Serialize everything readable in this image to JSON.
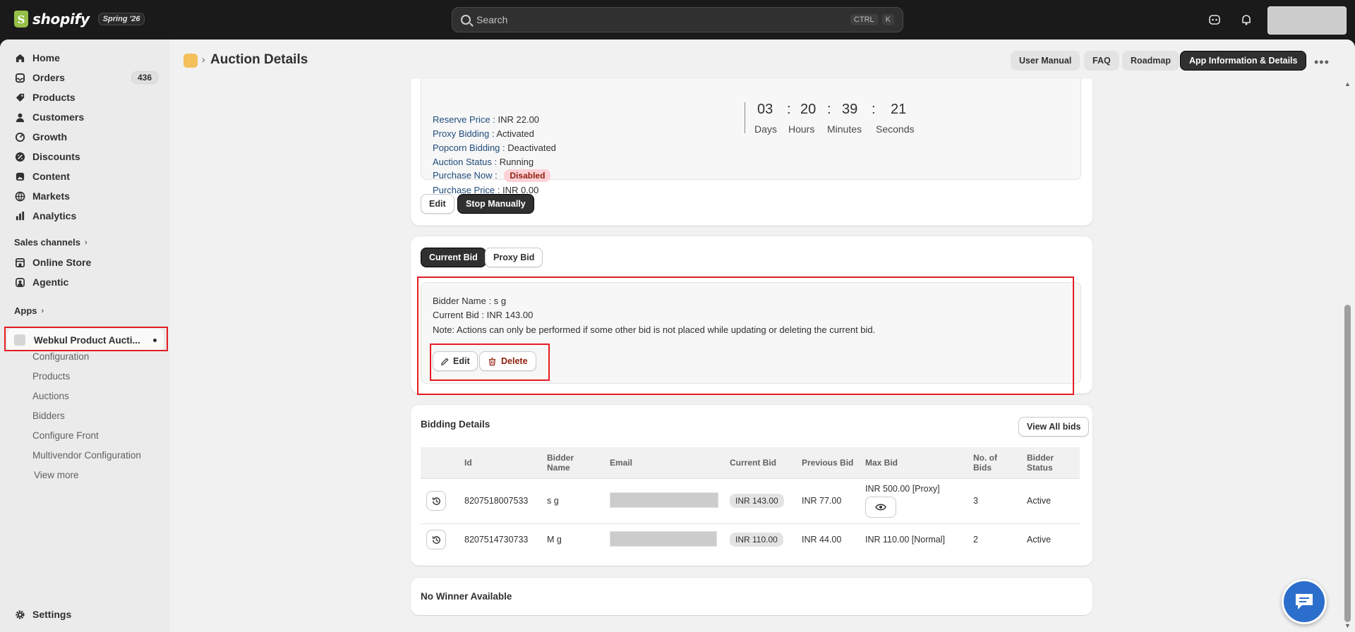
{
  "topbar": {
    "logo_text": "shopify",
    "badge": "Spring '26",
    "search_placeholder": "Search",
    "shortcut_1": "CTRL",
    "shortcut_2": "K"
  },
  "sidebar": {
    "items": [
      {
        "label": "Home",
        "icon": "home-icon"
      },
      {
        "label": "Orders",
        "icon": "orders-icon",
        "badge": "436"
      },
      {
        "label": "Products",
        "icon": "tag-icon"
      },
      {
        "label": "Customers",
        "icon": "person-icon"
      },
      {
        "label": "Growth",
        "icon": "growth-icon"
      },
      {
        "label": "Discounts",
        "icon": "discount-icon"
      },
      {
        "label": "Content",
        "icon": "content-icon"
      },
      {
        "label": "Markets",
        "icon": "globe-icon"
      },
      {
        "label": "Analytics",
        "icon": "chart-icon"
      }
    ],
    "sales_channels_label": "Sales channels",
    "channels": [
      {
        "label": "Online Store",
        "icon": "store-icon"
      },
      {
        "label": "Agentic",
        "icon": "agentic-icon"
      }
    ],
    "apps_label": "Apps",
    "active_app": "Webkul Product Aucti...",
    "app_sub_items": [
      "Configuration",
      "Products",
      "Auctions",
      "Bidders",
      "Configure Front",
      "Multivendor Configuration",
      "View more"
    ],
    "settings_label": "Settings"
  },
  "header": {
    "title": "Auction Details",
    "buttons": [
      "User Manual",
      "FAQ",
      "Roadmap",
      "App Information & Details"
    ]
  },
  "auction": {
    "fields": [
      {
        "key": "Reserve Price :",
        "value": "INR 22.00"
      },
      {
        "key": "Proxy Bidding :",
        "value": "Activated"
      },
      {
        "key": "Popcorn Bidding :",
        "value": "Deactivated"
      },
      {
        "key": "Auction Status :",
        "value": "Running"
      },
      {
        "key": "Purchase Now :",
        "value": "Disabled"
      },
      {
        "key": "Purchase Price :",
        "value": "INR 0.00"
      }
    ],
    "timer": {
      "days": "03",
      "hours": "20",
      "minutes": "39",
      "seconds": "21",
      "sep": ":",
      "labels": [
        "Days",
        "Hours",
        "Minutes",
        "Seconds"
      ]
    },
    "edit_label": "Edit",
    "stop_label": "Stop Manually"
  },
  "bid_tabs": {
    "current": "Current Bid",
    "proxy": "Proxy Bid"
  },
  "current_bid": {
    "bidder_line": "Bidder Name : s g",
    "bid_line": "Current Bid : INR 143.00",
    "note": "Note: Actions can only be performed if some other bid is not placed while updating or deleting the current bid.",
    "edit_label": "Edit",
    "delete_label": "Delete"
  },
  "bidding_details": {
    "title": "Bidding Details",
    "view_all": "View All bids",
    "columns": [
      "Id",
      "Bidder Name",
      "Email",
      "Current Bid",
      "Previous Bid",
      "Max Bid",
      "No. of Bids",
      "Bidder Status"
    ],
    "rows": [
      {
        "id": "8207518007533",
        "name": "s g",
        "current": "INR 143.00",
        "previous": "INR 77.00",
        "max": "INR 500.00 [Proxy]",
        "bids": "3",
        "status": "Active"
      },
      {
        "id": "8207514730733",
        "name": "M g",
        "current": "INR 110.00",
        "previous": "INR 44.00",
        "max": "INR 110.00 [Normal]",
        "bids": "2",
        "status": "Active"
      }
    ]
  },
  "winner": {
    "text": "No Winner Available"
  },
  "colors": {
    "accent_dark": "#303030",
    "highlight_red": "#e51c23",
    "chat_blue": "#2c6ecb"
  }
}
